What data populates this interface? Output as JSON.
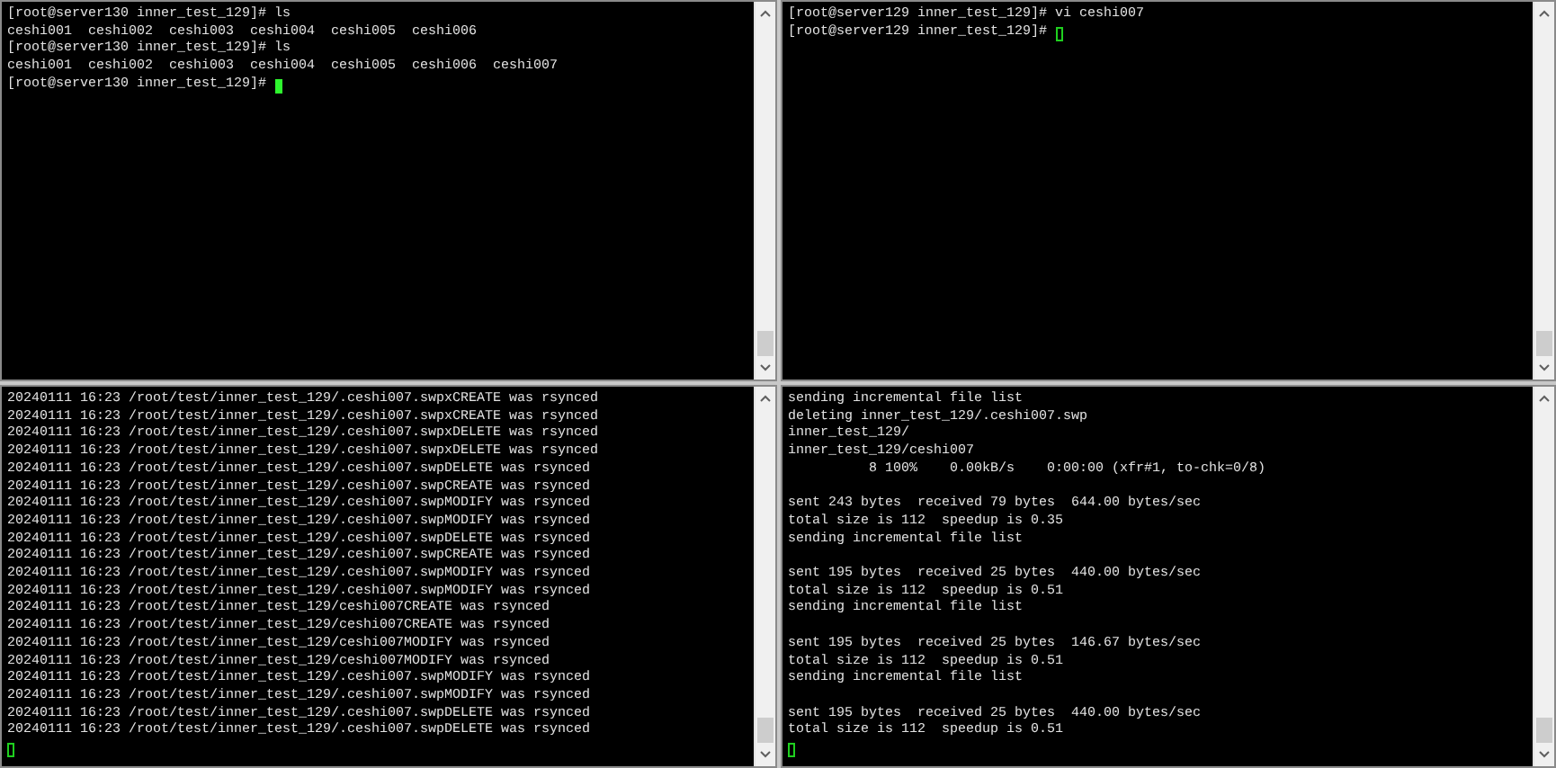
{
  "panes": [
    {
      "blocks": [
        [
          "[root@server130 inner_test_129]# ls",
          "ceshi001  ceshi002  ceshi003  ceshi004  ceshi005  ceshi006",
          "[root@server130 inner_test_129]# ls",
          "ceshi001  ceshi002  ceshi003  ceshi004  ceshi005  ceshi006  ceshi007"
        ]
      ],
      "cursor_line": {
        "prompt": "[root@server130 inner_test_129]# ",
        "cursor_focused": true
      }
    },
    {
      "blocks": [
        [
          "[root@server129 inner_test_129]# vi ceshi007"
        ]
      ],
      "cursor_line": {
        "prompt": "[root@server129 inner_test_129]# ",
        "cursor_focused": false
      }
    },
    {
      "blocks": [
        [
          "20240111 16:23 /root/test/inner_test_129/.ceshi007.swpxCREATE was rsynced",
          "20240111 16:23 /root/test/inner_test_129/.ceshi007.swpxCREATE was rsynced",
          "20240111 16:23 /root/test/inner_test_129/.ceshi007.swpxDELETE was rsynced",
          "20240111 16:23 /root/test/inner_test_129/.ceshi007.swpxDELETE was rsynced",
          "20240111 16:23 /root/test/inner_test_129/.ceshi007.swpDELETE was rsynced",
          "20240111 16:23 /root/test/inner_test_129/.ceshi007.swpCREATE was rsynced",
          "20240111 16:23 /root/test/inner_test_129/.ceshi007.swpMODIFY was rsynced",
          "20240111 16:23 /root/test/inner_test_129/.ceshi007.swpMODIFY was rsynced",
          "20240111 16:23 /root/test/inner_test_129/.ceshi007.swpDELETE was rsynced",
          "20240111 16:23 /root/test/inner_test_129/.ceshi007.swpCREATE was rsynced",
          "20240111 16:23 /root/test/inner_test_129/.ceshi007.swpMODIFY was rsynced",
          "20240111 16:23 /root/test/inner_test_129/.ceshi007.swpMODIFY was rsynced",
          "20240111 16:23 /root/test/inner_test_129/ceshi007CREATE was rsynced",
          "20240111 16:23 /root/test/inner_test_129/ceshi007CREATE was rsynced",
          "20240111 16:23 /root/test/inner_test_129/ceshi007MODIFY was rsynced",
          "20240111 16:23 /root/test/inner_test_129/ceshi007MODIFY was rsynced",
          "20240111 16:23 /root/test/inner_test_129/.ceshi007.swpMODIFY was rsynced",
          "20240111 16:23 /root/test/inner_test_129/.ceshi007.swpMODIFY was rsynced",
          "20240111 16:23 /root/test/inner_test_129/.ceshi007.swpDELETE was rsynced",
          "20240111 16:23 /root/test/inner_test_129/.ceshi007.swpDELETE was rsynced"
        ]
      ],
      "cursor_line": {
        "cursor_focused": false
      }
    },
    {
      "blocks": [
        [
          "sending incremental file list",
          "deleting inner_test_129/.ceshi007.swp",
          "inner_test_129/",
          "inner_test_129/ceshi007",
          "          8 100%    0.00kB/s    0:00:00 (xfr#1, to-chk=0/8)"
        ],
        [
          "sent 243 bytes  received 79 bytes  644.00 bytes/sec",
          "total size is 112  speedup is 0.35",
          "sending incremental file list"
        ],
        [
          "sent 195 bytes  received 25 bytes  440.00 bytes/sec",
          "total size is 112  speedup is 0.51",
          "sending incremental file list"
        ],
        [
          "sent 195 bytes  received 25 bytes  146.67 bytes/sec",
          "total size is 112  speedup is 0.51",
          "sending incremental file list"
        ],
        [
          "sent 195 bytes  received 25 bytes  440.00 bytes/sec",
          "total size is 112  speedup is 0.51"
        ]
      ],
      "cursor_line": {
        "cursor_focused": false
      }
    }
  ]
}
